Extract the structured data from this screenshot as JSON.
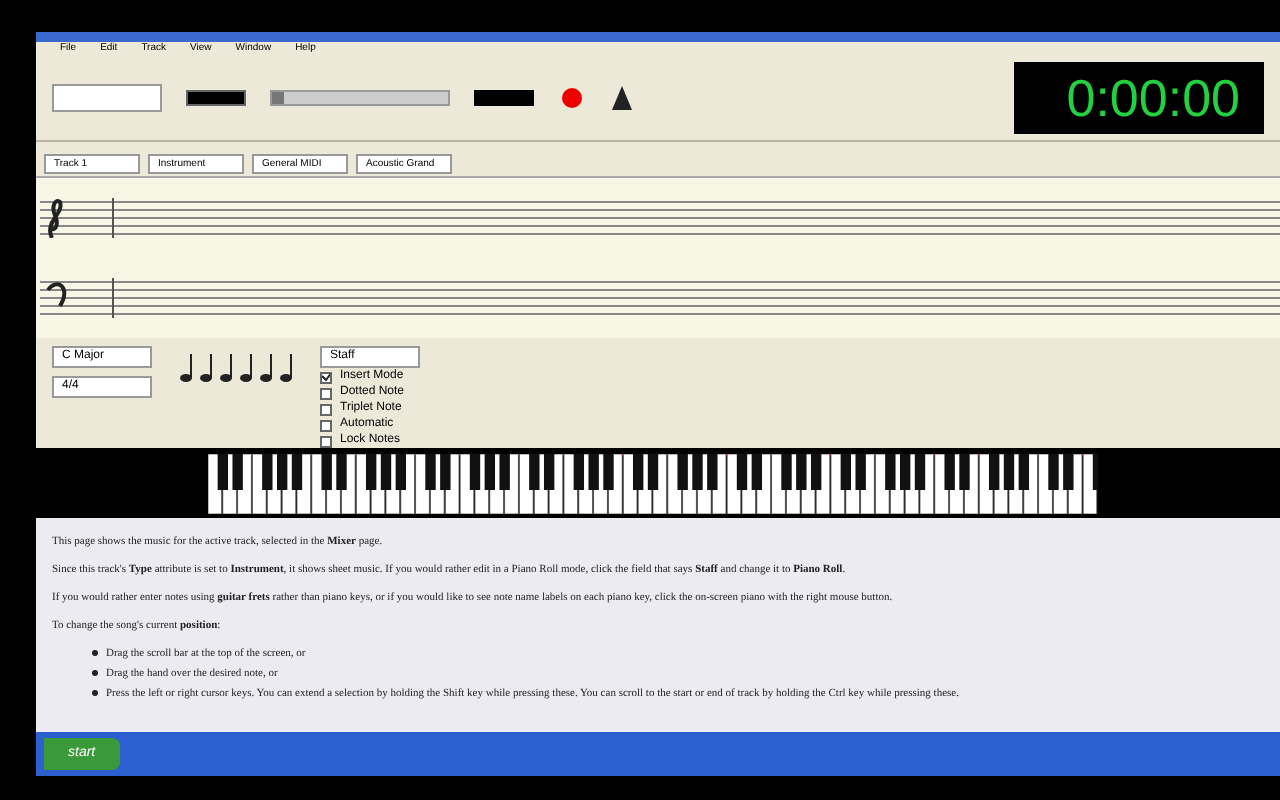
{
  "menu": [
    "File",
    "Edit",
    "Track",
    "View",
    "Window",
    "Help"
  ],
  "scroll": {
    "level": 0
  },
  "clock": "0:00:00",
  "track_row": [
    "Track 1",
    "Instrument",
    "General MIDI",
    "Acoustic Grand"
  ],
  "controls": {
    "key": "C Major",
    "meter": "4/4",
    "staff": "Staff",
    "checkboxes": [
      {
        "label": "Insert Mode",
        "checked": true
      },
      {
        "label": "Dotted Note",
        "checked": false
      },
      {
        "label": "Triplet Note",
        "checked": false
      },
      {
        "label": "Automatic",
        "checked": false
      },
      {
        "label": "Lock Notes",
        "checked": false
      }
    ]
  },
  "help": {
    "paragraphs": [
      "This page shows the music for the active track, selected in the **Mixer** page.",
      "Since this track's **Type** attribute is set to **Instrument**, it shows sheet music. If you would rather edit in a Piano Roll mode, click the field that says **Staff** and change it to **Piano Roll**.",
      "If you would rather enter notes using **guitar frets** rather than piano keys, or if you would like to see note name labels on each piano key, click the on-screen piano with the right mouse button.",
      "To change the song's current **position**:"
    ],
    "bullets": [
      "Drag the scroll bar at the top of the screen, or",
      "Drag the hand over the desired note, or",
      "Press the left or right cursor keys. You can extend a selection by holding the Shift key while pressing these. You can scroll to the start or end of track by holding the Ctrl key while pressing these."
    ]
  },
  "taskbar": {
    "start": "start"
  }
}
